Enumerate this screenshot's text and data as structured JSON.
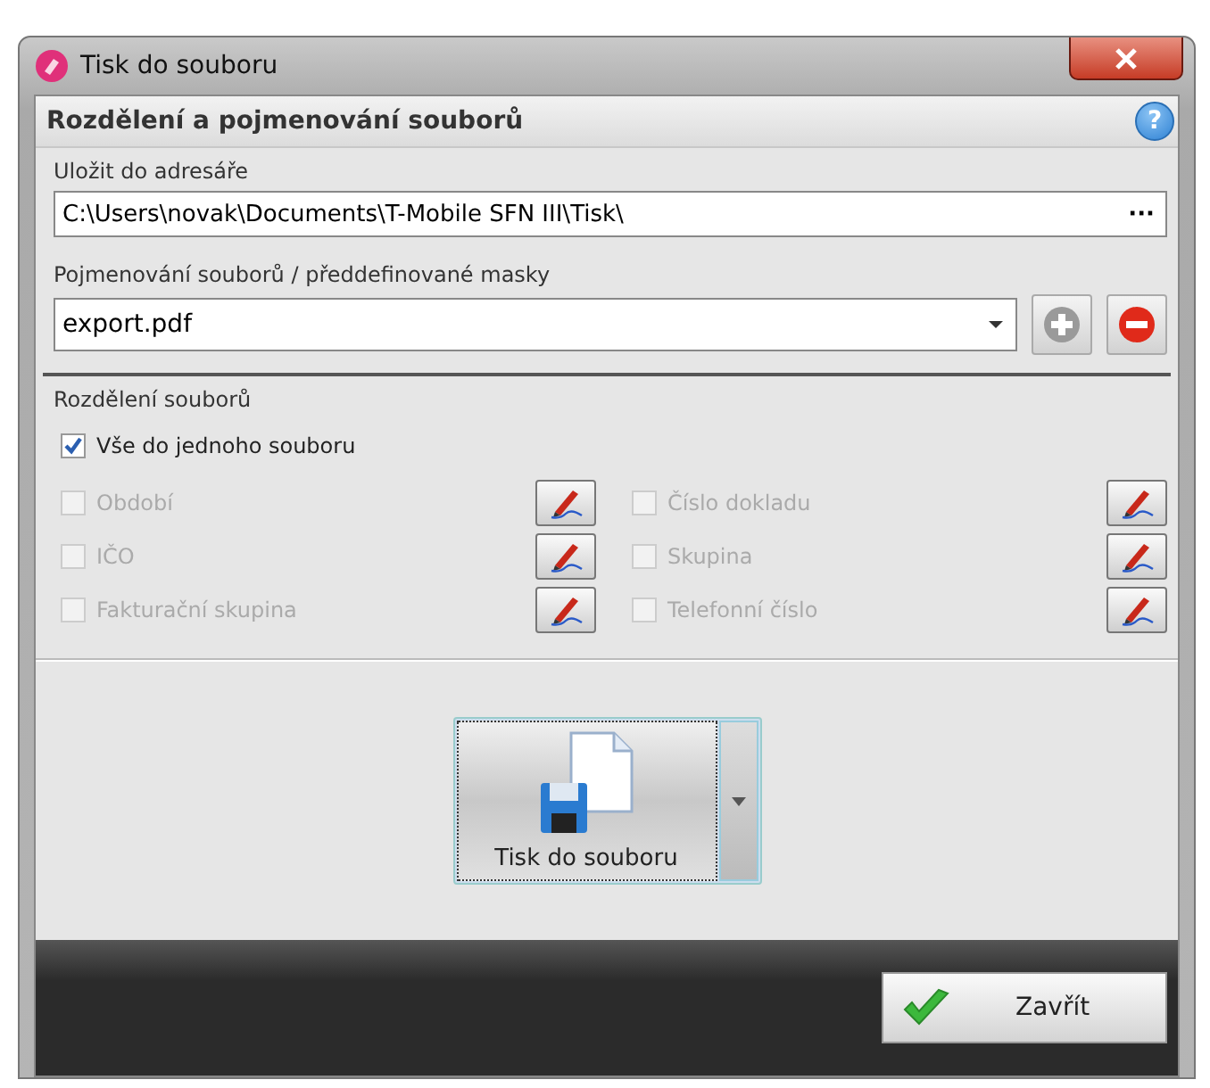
{
  "window": {
    "title": "Tisk do souboru"
  },
  "section": {
    "title": "Rozdělení a pojmenování souborů",
    "help": "?"
  },
  "directory": {
    "label": "Uložit do adresáře",
    "value": "C:\\Users\\novak\\Documents\\T-Mobile SFN III\\Tisk\\",
    "browse": "···"
  },
  "naming": {
    "label": "Pojmenování souborů / předdefinované masky",
    "value": "export.pdf",
    "add_disabled": true
  },
  "split": {
    "label": "Rozdělení souborů",
    "all_in_one": {
      "label": "Vše do jednoho souboru",
      "checked": true
    },
    "options": [
      {
        "label": "Období",
        "checked": false,
        "disabled": true
      },
      {
        "label": "Číslo dokladu",
        "checked": false,
        "disabled": true
      },
      {
        "label": "IČO",
        "checked": false,
        "disabled": true
      },
      {
        "label": "Skupina",
        "checked": false,
        "disabled": true
      },
      {
        "label": "Fakturační skupina",
        "checked": false,
        "disabled": true
      },
      {
        "label": "Telefonní číslo",
        "checked": false,
        "disabled": true
      }
    ]
  },
  "print_button": {
    "label": "Tisk do souboru"
  },
  "close_button": {
    "label": "Zavřít"
  }
}
